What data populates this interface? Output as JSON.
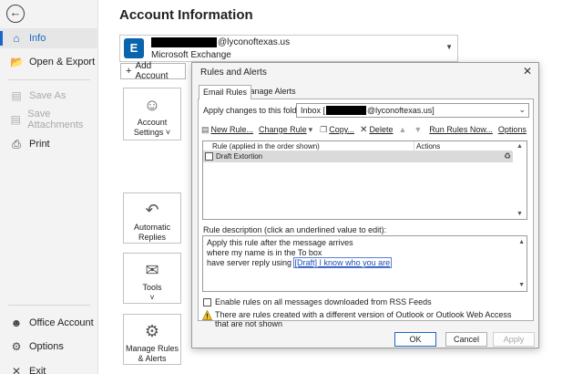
{
  "nav": {
    "back_icon": "back-arrow-icon",
    "items": [
      {
        "label": "Info",
        "icon": "home-icon",
        "active": true
      },
      {
        "label": "Open & Export",
        "icon": "folder-open-icon"
      },
      {
        "label": "Save As",
        "icon": "save-as-icon",
        "disabled": true
      },
      {
        "label": "Save Attachments",
        "icon": "save-attachments-icon",
        "disabled": true
      },
      {
        "label": "Print",
        "icon": "printer-icon"
      },
      {
        "label": "Office Account",
        "icon": "person-icon"
      },
      {
        "label": "Options",
        "icon": "options-icon"
      },
      {
        "label": "Exit",
        "icon": "exit-icon"
      }
    ],
    "accent_color": "#1a66c8"
  },
  "main": {
    "title": "Account Information",
    "account": {
      "email_domain": "@lyconoftexas.us",
      "type": "Microsoft Exchange",
      "logo_letter": "E"
    },
    "add_account_label": "Add Account",
    "tiles": [
      {
        "label_1": "Account",
        "label_2": "Settings ˅"
      },
      {
        "label_1": "Automatic",
        "label_2": "Replies"
      },
      {
        "label_1": "Tools",
        "label_2": "˅"
      },
      {
        "label_1": "Manage Rules",
        "label_2": "& Alerts"
      }
    ]
  },
  "dialog": {
    "title": "Rules and Alerts",
    "tabs": [
      "Email Rules",
      "Manage Alerts"
    ],
    "apply_label": "Apply changes to this folder:",
    "folder_prefix": "Inbox [",
    "folder_suffix": "@lyconoftexas.us]",
    "toolbar": {
      "new_rule": "New Rule...",
      "change_rule": "Change Rule",
      "copy": "Copy...",
      "delete": "Delete",
      "run_rules_now": "Run Rules Now...",
      "options": "Options"
    },
    "table": {
      "col_rule": "Rule (applied in the order shown)",
      "col_actions": "Actions",
      "rows": [
        {
          "name": "Draft Extortion",
          "checked": false
        }
      ]
    },
    "description_label": "Rule description (click an underlined value to edit):",
    "description": {
      "line_1": "Apply this rule after the message arrives",
      "line_2": "where my name is in the To box",
      "line_3_prefix": "have server reply using ",
      "line_3_link": "[Draft] I know who you are"
    },
    "rss_label": "Enable rules on all messages downloaded from RSS Feeds",
    "warning_text": "There are rules created with a different version of Outlook or Outlook Web Access that are not shown",
    "buttons": {
      "ok": "OK",
      "cancel": "Cancel",
      "apply": "Apply"
    }
  }
}
